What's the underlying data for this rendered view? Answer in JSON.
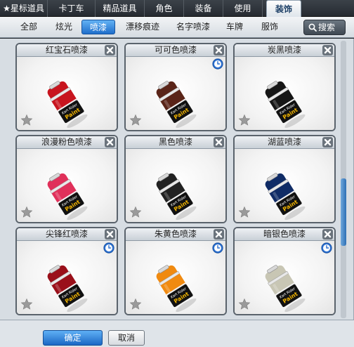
{
  "top_tabs": [
    {
      "label": "★星标道具"
    },
    {
      "label": "卡丁车"
    },
    {
      "label": "精品道具"
    },
    {
      "label": "角色"
    },
    {
      "label": "装备"
    },
    {
      "label": "使用"
    },
    {
      "label": "装饰",
      "active": true
    }
  ],
  "sub_tabs": [
    {
      "label": "全部"
    },
    {
      "label": "炫光"
    },
    {
      "label": "喷漆",
      "active": true
    },
    {
      "label": "漂移痕迹"
    },
    {
      "label": "名字喷漆"
    },
    {
      "label": "车牌"
    },
    {
      "label": "服饰"
    }
  ],
  "search": {
    "label": "搜索",
    "icon": "magnifier-icon"
  },
  "items": [
    {
      "name": "红宝石喷漆",
      "color": "#c8141e",
      "timed": false
    },
    {
      "name": "可可色喷漆",
      "color": "#5a2418",
      "timed": true
    },
    {
      "name": "炭黑喷漆",
      "color": "#161616",
      "timed": false
    },
    {
      "name": "浪漫粉色喷漆",
      "color": "#e0305a",
      "timed": false
    },
    {
      "name": "黑色喷漆",
      "color": "#222222",
      "timed": false
    },
    {
      "name": "湖蓝喷漆",
      "color": "#102c66",
      "timed": false
    },
    {
      "name": "尖锋红喷漆",
      "color": "#9a101a",
      "timed": true
    },
    {
      "name": "朱黄色喷漆",
      "color": "#f08a10",
      "timed": true
    },
    {
      "name": "暗银色喷漆",
      "color": "#c8c6b4",
      "timed": true
    }
  ],
  "can_label": {
    "line1": "Kart Rider",
    "line2": "Paint"
  },
  "footer": {
    "ok_label": "确定",
    "cancel_label": "取消"
  },
  "colors": {
    "accent": "#1f6ecb",
    "card_border": "#5a636c",
    "clock": "#2a6fd0"
  }
}
